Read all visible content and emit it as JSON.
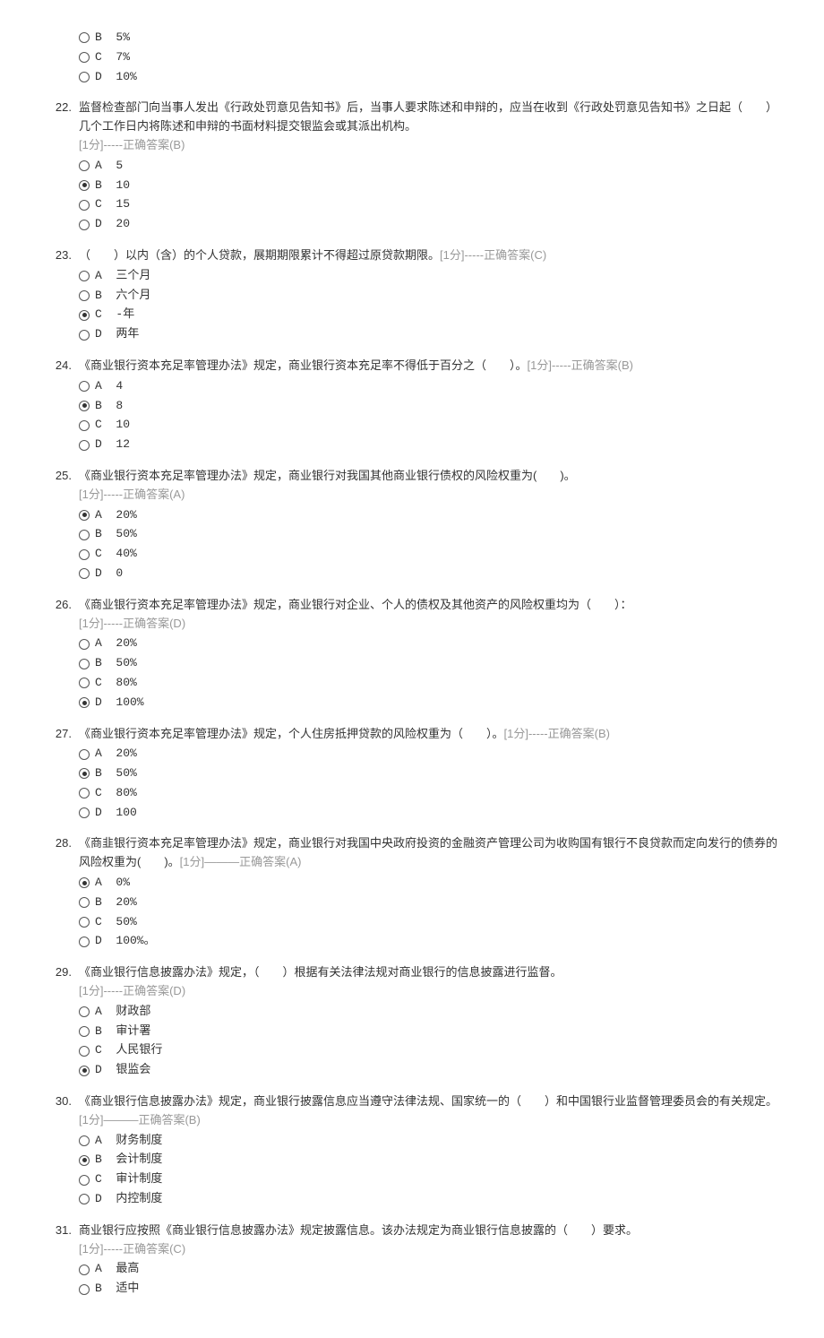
{
  "questions": [
    {
      "num": "",
      "text": "",
      "meta": "",
      "options": [
        {
          "letter": "B",
          "text": "5%",
          "selected": false
        },
        {
          "letter": "C",
          "text": "7%",
          "selected": false
        },
        {
          "letter": "D",
          "text": "10%",
          "selected": false
        }
      ]
    },
    {
      "num": "22.",
      "text": "监督检查部门向当事人发出《行政处罚意见告知书》后，当事人要求陈述和申辩的，应当在收到《行政处罚意见告知书》之日起（　　）几个工作日内将陈述和申辩的书面材料提交银监会或其派出机构。",
      "meta": "[1分]-----正确答案(B)",
      "options": [
        {
          "letter": "A",
          "text": "5",
          "selected": false
        },
        {
          "letter": "B",
          "text": "10",
          "selected": true
        },
        {
          "letter": "C",
          "text": "15",
          "selected": false
        },
        {
          "letter": "D",
          "text": "20",
          "selected": false
        }
      ]
    },
    {
      "num": "23.",
      "text": "（　　）以内（含）的个人贷款，展期期限累计不得超过原贷款期限。",
      "meta": "[1分]-----正确答案(C)",
      "metaInline": true,
      "options": [
        {
          "letter": "A",
          "text": "三个月",
          "selected": false
        },
        {
          "letter": "B",
          "text": "六个月",
          "selected": false
        },
        {
          "letter": "C",
          "text": "-年",
          "selected": true
        },
        {
          "letter": "D",
          "text": "两年",
          "selected": false
        }
      ]
    },
    {
      "num": "24.",
      "text": "《商业银行资本充足率管理办法》规定，商业银行资本充足率不得低于百分之（　　）。",
      "meta": "[1分]-----正确答案(B)",
      "metaInline": true,
      "options": [
        {
          "letter": "A",
          "text": "4",
          "selected": false
        },
        {
          "letter": "B",
          "text": "8",
          "selected": true
        },
        {
          "letter": "C",
          "text": "10",
          "selected": false
        },
        {
          "letter": "D",
          "text": "12",
          "selected": false
        }
      ]
    },
    {
      "num": "25.",
      "text": "《商业银行资本充足率管理办法》规定，商业银行对我国其他商业银行债权的风险权重为(　　)。",
      "meta": "[1分]-----正确答案(A)",
      "options": [
        {
          "letter": "A",
          "text": "20%",
          "selected": true
        },
        {
          "letter": "B",
          "text": "50%",
          "selected": false
        },
        {
          "letter": "C",
          "text": "40%",
          "selected": false
        },
        {
          "letter": "D",
          "text": "0",
          "selected": false
        }
      ]
    },
    {
      "num": "26.",
      "text": "《商业银行资本充足率管理办法》规定，商业银行对企业、个人的债权及其他资产的风险权重均为（　　）：",
      "meta": "[1分]-----正确答案(D)",
      "options": [
        {
          "letter": "A",
          "text": "20%",
          "selected": false
        },
        {
          "letter": "B",
          "text": "50%",
          "selected": false
        },
        {
          "letter": "C",
          "text": "80%",
          "selected": false
        },
        {
          "letter": "D",
          "text": "100%",
          "selected": true
        }
      ]
    },
    {
      "num": "27.",
      "text": "《商业银行资本充足率管理办法》规定，个人住房抵押贷款的风险权重为（　　）。",
      "meta": "[1分]-----正确答案(B)",
      "metaInline": true,
      "options": [
        {
          "letter": "A",
          "text": "20%",
          "selected": false
        },
        {
          "letter": "B",
          "text": "50%",
          "selected": true
        },
        {
          "letter": "C",
          "text": "80%",
          "selected": false
        },
        {
          "letter": "D",
          "text": "100",
          "selected": false
        }
      ]
    },
    {
      "num": "28.",
      "text": "《商韭银行资本充足率管理办法》规定，商业银行对我国中央政府投资的金融资产管理公司为收购国有银行不良贷款而定向发行的债券的风险权重为(　　)。",
      "meta": "[1分]———正确答案(A)",
      "metaInline": true,
      "options": [
        {
          "letter": "A",
          "text": "0%",
          "selected": true
        },
        {
          "letter": "B",
          "text": "20%",
          "selected": false
        },
        {
          "letter": "C",
          "text": "50%",
          "selected": false
        },
        {
          "letter": "D",
          "text": "100%。",
          "selected": false
        }
      ]
    },
    {
      "num": "29.",
      "text": "《商业银行信息披露办法》规定，（　　）根据有关法律法规对商业银行的信息披露进行监督。",
      "meta": "[1分]-----正确答案(D)",
      "options": [
        {
          "letter": "A",
          "text": "财政部",
          "selected": false
        },
        {
          "letter": "B",
          "text": "审计署",
          "selected": false
        },
        {
          "letter": "C",
          "text": "人民银行",
          "selected": false
        },
        {
          "letter": "D",
          "text": "银监会",
          "selected": true
        }
      ]
    },
    {
      "num": "30.",
      "text": "《商业银行信息披露办法》规定，商业银行披露信息应当遵守法律法规、国家统一的（　　）和中国银行业监督管理委员会的有关规定。",
      "meta": "[1分]———正确答案(B)",
      "metaInline": true,
      "options": [
        {
          "letter": "A",
          "text": "财务制度",
          "selected": false
        },
        {
          "letter": "B",
          "text": "会计制度",
          "selected": true
        },
        {
          "letter": "C",
          "text": "审计制度",
          "selected": false
        },
        {
          "letter": "D",
          "text": "内控制度",
          "selected": false
        }
      ]
    },
    {
      "num": "31.",
      "text": "商业银行应按照《商业银行信息披露办法》规定披露信息。该办法规定为商业银行信息披露的（　　）要求。",
      "meta": "[1分]-----正确答案(C)",
      "options": [
        {
          "letter": "A",
          "text": "最高",
          "selected": false
        },
        {
          "letter": "B",
          "text": "适中",
          "selected": false
        }
      ]
    }
  ]
}
